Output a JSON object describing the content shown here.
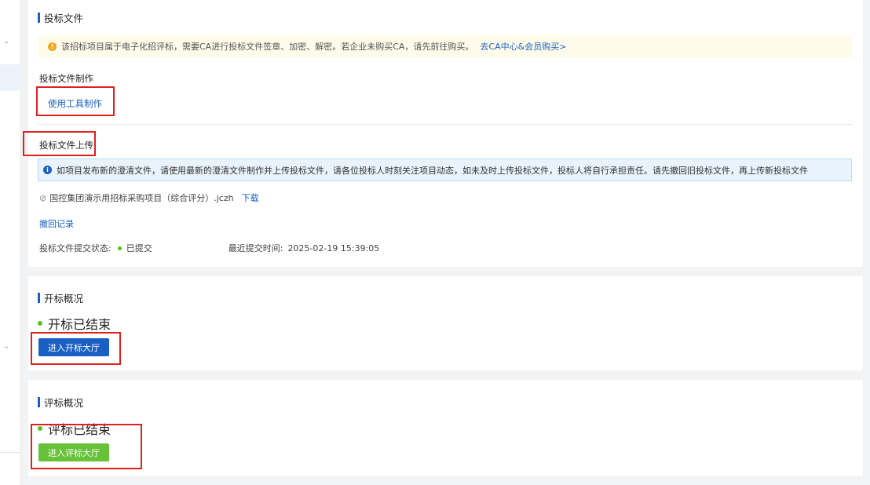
{
  "sidebar": {
    "chevron_up": "⌃",
    "chevron_down": "⌄"
  },
  "bid_file_section": {
    "title": "投标文件",
    "warning": {
      "text": "该招标项目属于电子化招评标，需要CA进行投标文件签章、加密、解密。若企业未购买CA，请先前往购买。",
      "link": "去CA中心&会员购买>"
    },
    "make": {
      "title": "投标文件制作",
      "tool_link": "使用工具制作"
    },
    "upload": {
      "title": "投标文件上传",
      "info": "如项目发布新的澄清文件，请使用最新的澄清文件制作并上传投标文件，请各位投标人时刻关注项目动态，如未及时上传投标文件，投标人将自行承担责任。请先撤回旧投标文件，再上传新投标文件",
      "file_name": "国控集团演示用招标采购项目（综合评分）.jczh",
      "download": "下载",
      "withdraw_record": "撤回记录",
      "status_label": "投标文件提交状态:",
      "status_value": "已提交",
      "time_label": "最近提交时间:",
      "time_value": "2025-02-19 15:39:05"
    }
  },
  "opening_section": {
    "title": "开标概况",
    "status": "开标已结束",
    "button": "进入开标大厅"
  },
  "evaluation_section": {
    "title": "评标概况",
    "status": "评标已结束",
    "button": "进入评标大厅"
  },
  "colors": {
    "primary": "#1a5fc4",
    "success": "#52c41a",
    "green_button": "#67c23a",
    "warning": "#f0a91c",
    "highlight_box": "#e02020"
  },
  "icons": {
    "warning": "warning-circle-icon",
    "info": "info-circle-icon",
    "attachment": "paperclip-icon",
    "status_dot": "dot-icon"
  }
}
